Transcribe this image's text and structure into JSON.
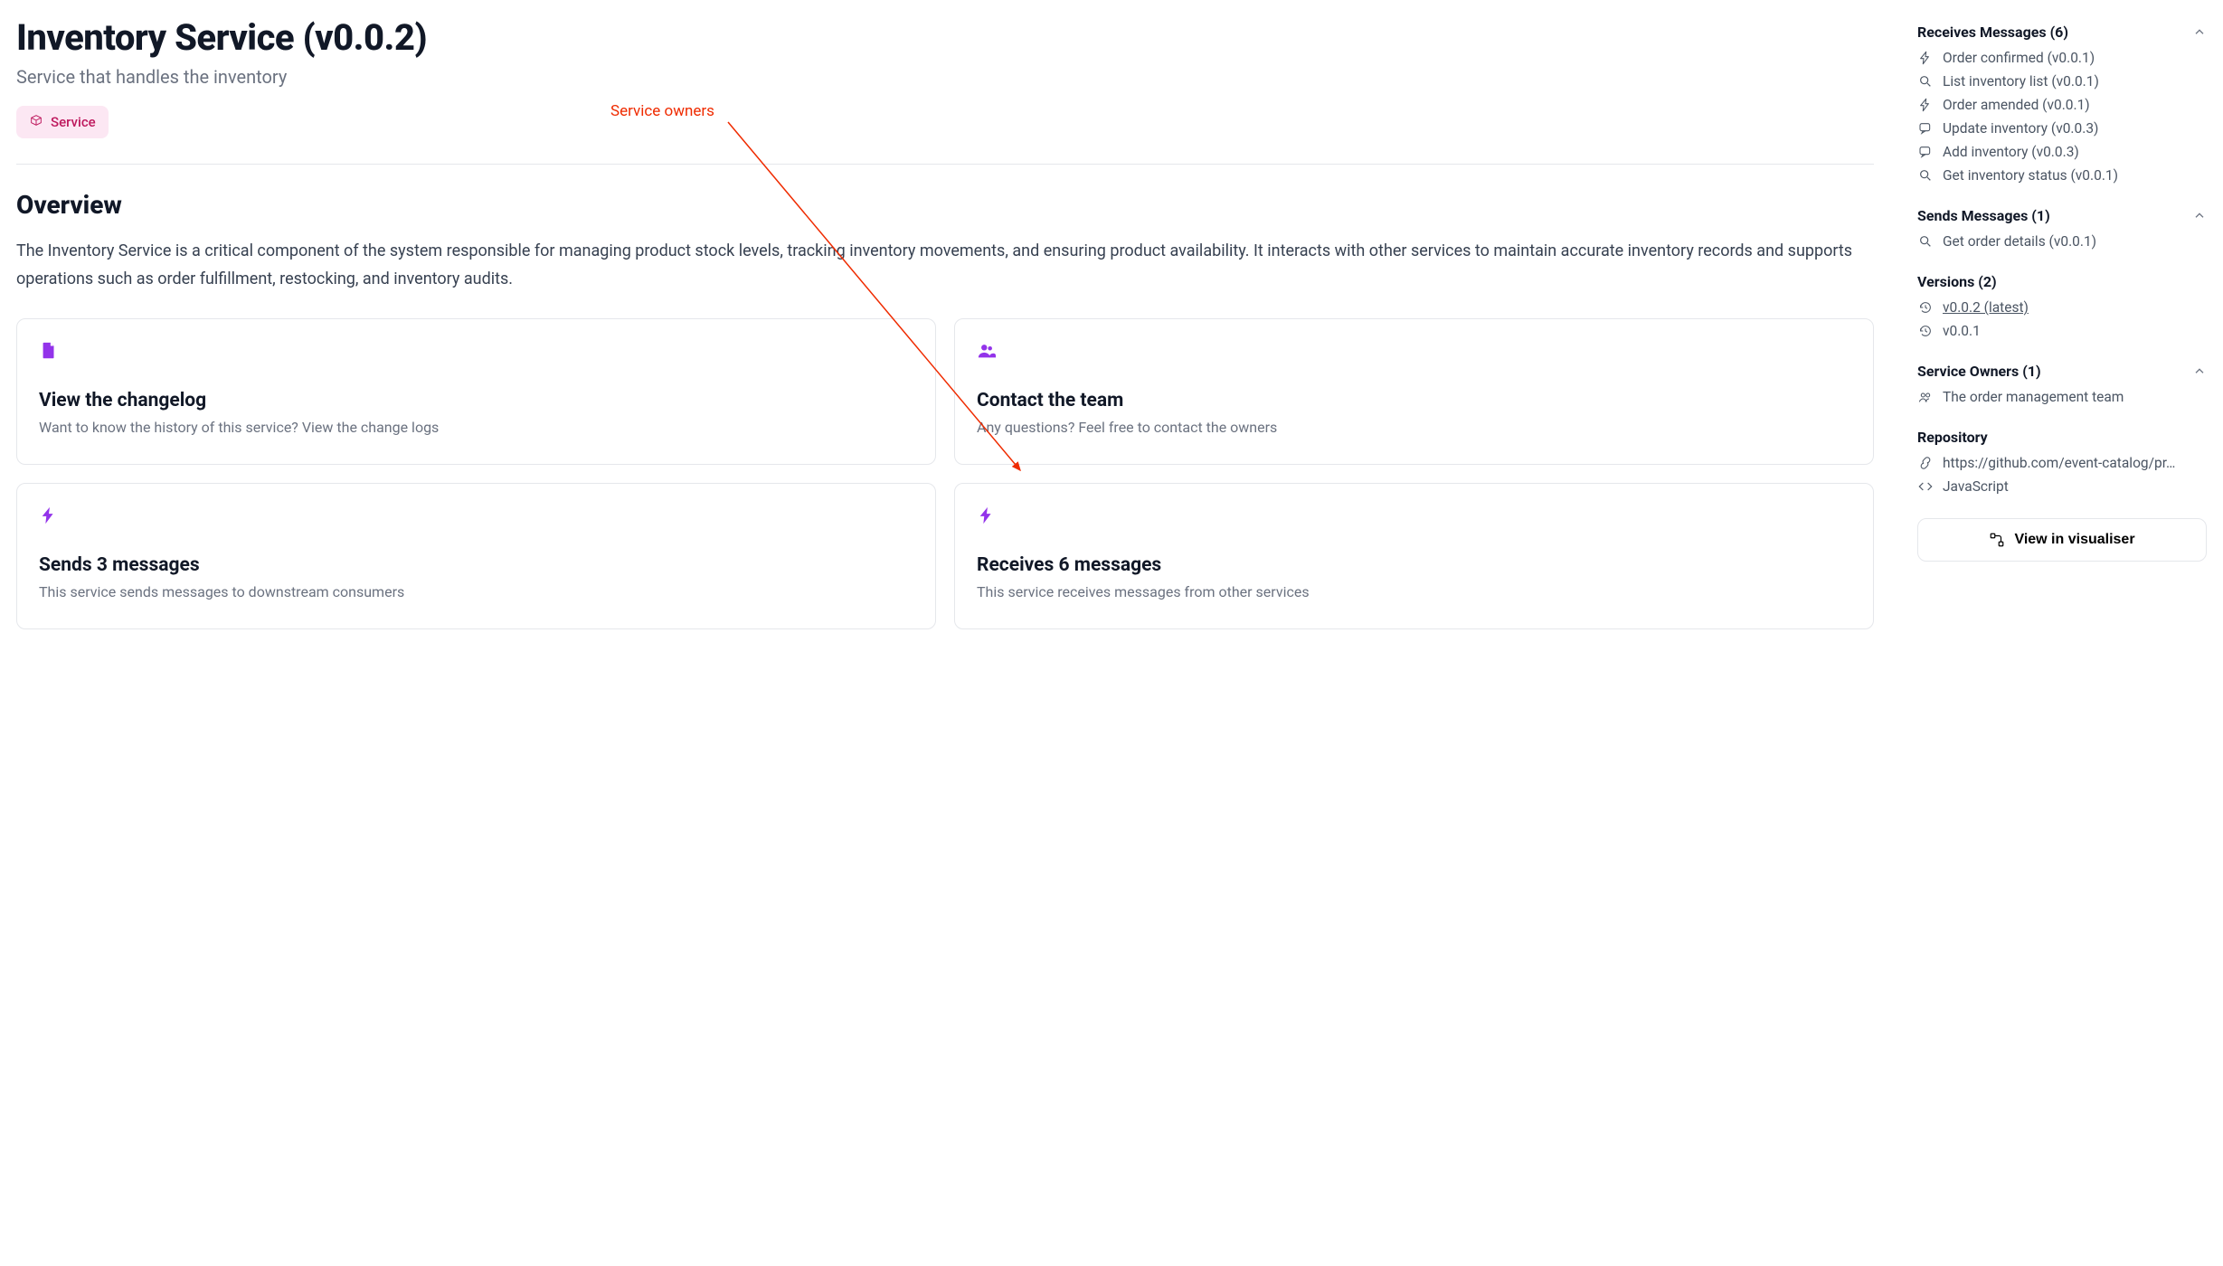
{
  "header": {
    "title": "Inventory Service (v0.0.2)",
    "subtitle": "Service that handles the inventory",
    "badge": "Service"
  },
  "overview": {
    "heading": "Overview",
    "text": "The Inventory Service is a critical component of the system responsible for managing product stock levels, tracking inventory movements, and ensuring product availability. It interacts with other services to maintain accurate inventory records and supports operations such as order fulfillment, restocking, and inventory audits."
  },
  "cards": {
    "changelog": {
      "title": "View the changelog",
      "desc": "Want to know the history of this service? View the change logs"
    },
    "contact": {
      "title": "Contact the team",
      "desc": "Any questions? Feel free to contact the owners"
    },
    "sends": {
      "title": "Sends 3 messages",
      "desc": "This service sends messages to downstream consumers"
    },
    "receives": {
      "title": "Receives 6 messages",
      "desc": "This service receives messages from other services"
    }
  },
  "sidebar": {
    "receives": {
      "heading": "Receives Messages (6)",
      "items": [
        {
          "icon": "bolt",
          "label": "Order confirmed (v0.0.1)"
        },
        {
          "icon": "search",
          "label": "List inventory list (v0.0.1)"
        },
        {
          "icon": "bolt",
          "label": "Order amended (v0.0.1)"
        },
        {
          "icon": "message",
          "label": "Update inventory (v0.0.3)"
        },
        {
          "icon": "message",
          "label": "Add inventory (v0.0.3)"
        },
        {
          "icon": "search",
          "label": "Get inventory status (v0.0.1)"
        }
      ]
    },
    "sends": {
      "heading": "Sends Messages (1)",
      "items": [
        {
          "icon": "search",
          "label": "Get order details (v0.0.1)"
        }
      ]
    },
    "versions": {
      "heading": "Versions (2)",
      "items": [
        {
          "icon": "history",
          "label": "v0.0.2 (latest)",
          "underline": true
        },
        {
          "icon": "history",
          "label": "v0.0.1"
        }
      ]
    },
    "owners": {
      "heading": "Service Owners (1)",
      "items": [
        {
          "icon": "team",
          "label": "The order management team"
        }
      ]
    },
    "repo": {
      "heading": "Repository",
      "url": "https://github.com/event-catalog/pr…",
      "lang": "JavaScript"
    },
    "vis_btn": "View in visualiser"
  },
  "annotation": {
    "label": "Service owners"
  }
}
